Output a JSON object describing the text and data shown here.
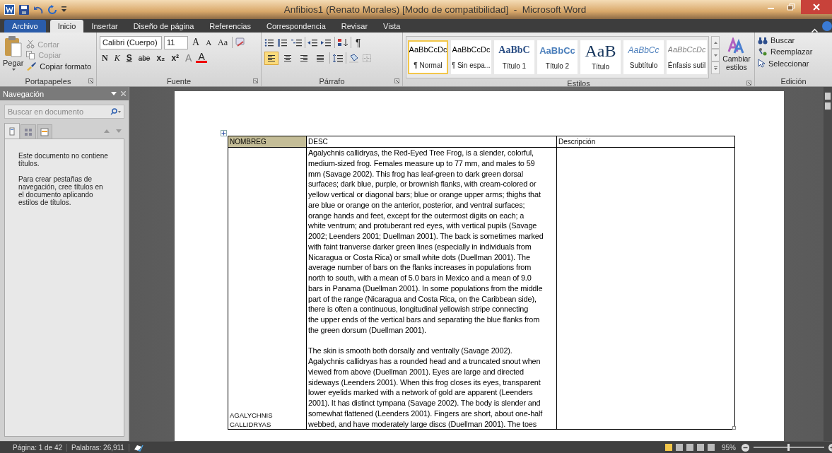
{
  "window": {
    "title": "Anfibios1 (Renato Morales) [Modo de compatibilidad]  -  Microsoft Word"
  },
  "tabs": [
    {
      "label": "Archivo",
      "kind": "file",
      "selected": false
    },
    {
      "label": "Inicio",
      "kind": "tab",
      "selected": true
    },
    {
      "label": "Insertar",
      "kind": "tab",
      "selected": false
    },
    {
      "label": "Diseño de página",
      "kind": "tab",
      "selected": false
    },
    {
      "label": "Referencias",
      "kind": "tab",
      "selected": false
    },
    {
      "label": "Correspondencia",
      "kind": "tab",
      "selected": false
    },
    {
      "label": "Revisar",
      "kind": "tab",
      "selected": false
    },
    {
      "label": "Vista",
      "kind": "tab",
      "selected": false
    }
  ],
  "clipboard": {
    "group": "Portapapeles",
    "paste": "Pegar",
    "items": [
      {
        "label": "Cortar",
        "kind": "cut",
        "disabled": true
      },
      {
        "label": "Copiar",
        "kind": "copy",
        "disabled": true
      },
      {
        "label": "Copiar formato",
        "kind": "painter",
        "disabled": false
      }
    ]
  },
  "font": {
    "group": "Fuente",
    "name": "Calibri (Cuerpo)",
    "size": "11",
    "row1": [
      {
        "label": "A",
        "kind": "grow"
      },
      {
        "label": "A",
        "kind": "shrink"
      },
      {
        "label": "Aa",
        "kind": "case"
      }
    ],
    "row2": [
      {
        "label": "N",
        "kind": "bold"
      },
      {
        "label": "K",
        "kind": "italic"
      },
      {
        "label": "S",
        "kind": "underline"
      },
      {
        "label": "abe",
        "kind": "strike"
      },
      {
        "label": "x₂",
        "kind": "sub"
      },
      {
        "label": "x²",
        "kind": "sup"
      },
      {
        "label": "A",
        "kind": "effects"
      },
      {
        "label": "A",
        "kind": "color"
      }
    ]
  },
  "paragraph": {
    "group": "Párrafo",
    "pilcrow": "¶",
    "alignments": [
      {
        "kind": "left",
        "selected": true
      },
      {
        "kind": "center",
        "selected": false
      },
      {
        "kind": "right",
        "selected": false
      },
      {
        "kind": "justify",
        "selected": false
      }
    ]
  },
  "styles": {
    "group": "Estilos",
    "change": "Cambiar estilos",
    "items": [
      {
        "preview": "AaBbCcDc",
        "name": "¶ Normal",
        "kind": "normal",
        "selected": true
      },
      {
        "preview": "AaBbCcDc",
        "name": "¶ Sin espa...",
        "kind": "normal",
        "selected": false
      },
      {
        "preview": "AaBbC",
        "name": "Título 1",
        "kind": "heading1",
        "selected": false
      },
      {
        "preview": "AaBbCc",
        "name": "Título 2",
        "kind": "heading2",
        "selected": false
      },
      {
        "preview": "AaB",
        "name": "Título",
        "kind": "title",
        "selected": false
      },
      {
        "preview": "AaBbCc",
        "name": "Subtítulo",
        "kind": "subtitle",
        "selected": false
      },
      {
        "preview": "AaBbCcDc",
        "name": "Énfasis sutil",
        "kind": "emphasis",
        "selected": false
      }
    ]
  },
  "editing": {
    "group": "Edición",
    "items": [
      {
        "label": "Buscar",
        "kind": "find"
      },
      {
        "label": "Reemplazar",
        "kind": "replace"
      },
      {
        "label": "Seleccionar",
        "kind": "select"
      }
    ]
  },
  "navigation": {
    "title": "Navegación",
    "search_placeholder": "Buscar en documento",
    "tabs": [
      {
        "kind": "headings",
        "selected": true
      },
      {
        "kind": "pages",
        "selected": false
      },
      {
        "kind": "results",
        "selected": false
      }
    ],
    "messages": [
      "Este documento no contiene títulos.",
      "Para crear pestañas de navegación, cree títulos en el documento aplicando estilos de títulos."
    ]
  },
  "table": {
    "columns": [
      "NOMBREG",
      "DESC",
      "Descripción"
    ],
    "rows": [
      {
        "nombreg": "AGALYCHNIS CALLIDRYAS",
        "desc": [
          [
            "Agalychnis callidryas, the Red-Eyed Tree Frog, is a slender, colorful,",
            "medium-sized frog. Females measure up to 77 mm, and males to 59",
            "mm (Savage 2002). This frog has leaf-green to dark green dorsal",
            "surfaces; dark blue, purple, or brownish flanks, with cream-colored or",
            "yellow vertical or diagonal bars; blue or orange upper arms; thighs that",
            "are blue or orange on the anterior, posterior, and ventral surfaces;",
            "orange hands and feet, except for the outermost digits on each; a",
            "white ventrum; and protuberant red eyes, with vertical pupils (Savage",
            "2002; Leenders 2001; Duellman 2001). The back is sometimes marked",
            "with faint tranverse darker green lines (especially in individuals  from",
            "Nicaragua or Costa Rica) or small white dots (Duellman 2001). The",
            "average number of bars on the flanks increases in populations  from",
            "north to south, with a mean of 5.0 bars in Mexico and a mean of 9.0",
            "bars in Panama (Duellman 2001). In some populations from the middle",
            "part of the range (Nicaragua and Costa Rica, on the Caribbean side),",
            "there is often a continuous, longitudinal yellowish stripe connecting",
            "the upper ends of the vertical bars and separating the blue flanks from",
            "the green dorsum (Duellman 2001)."
          ],
          [
            "The skin is smooth both dorsally and ventrally (Savage 2002).",
            "Agalychnis callidryas has a rounded  head and a truncated snout when",
            "viewed from above (Duellman 2001). Eyes are large and directed",
            "sideways (Leenders 2001). When this frog closes its eyes, transparent",
            "lower eyelids  marked with a network of gold are apparent (Leenders",
            "2001). It has distinct tympana (Savage 2002). The body is slender and",
            "somewhat flattened (Leenders 2001). Fingers are short, about one-half",
            "webbed, and have moderately large discs (Duellman 2001). The toes"
          ]
        ]
      }
    ]
  },
  "status_bar": {
    "page": "Página: 1 de 42",
    "words": "Palabras: 26,911",
    "zoom": "95%",
    "zoom_slider": {
      "level": 0.48
    }
  }
}
